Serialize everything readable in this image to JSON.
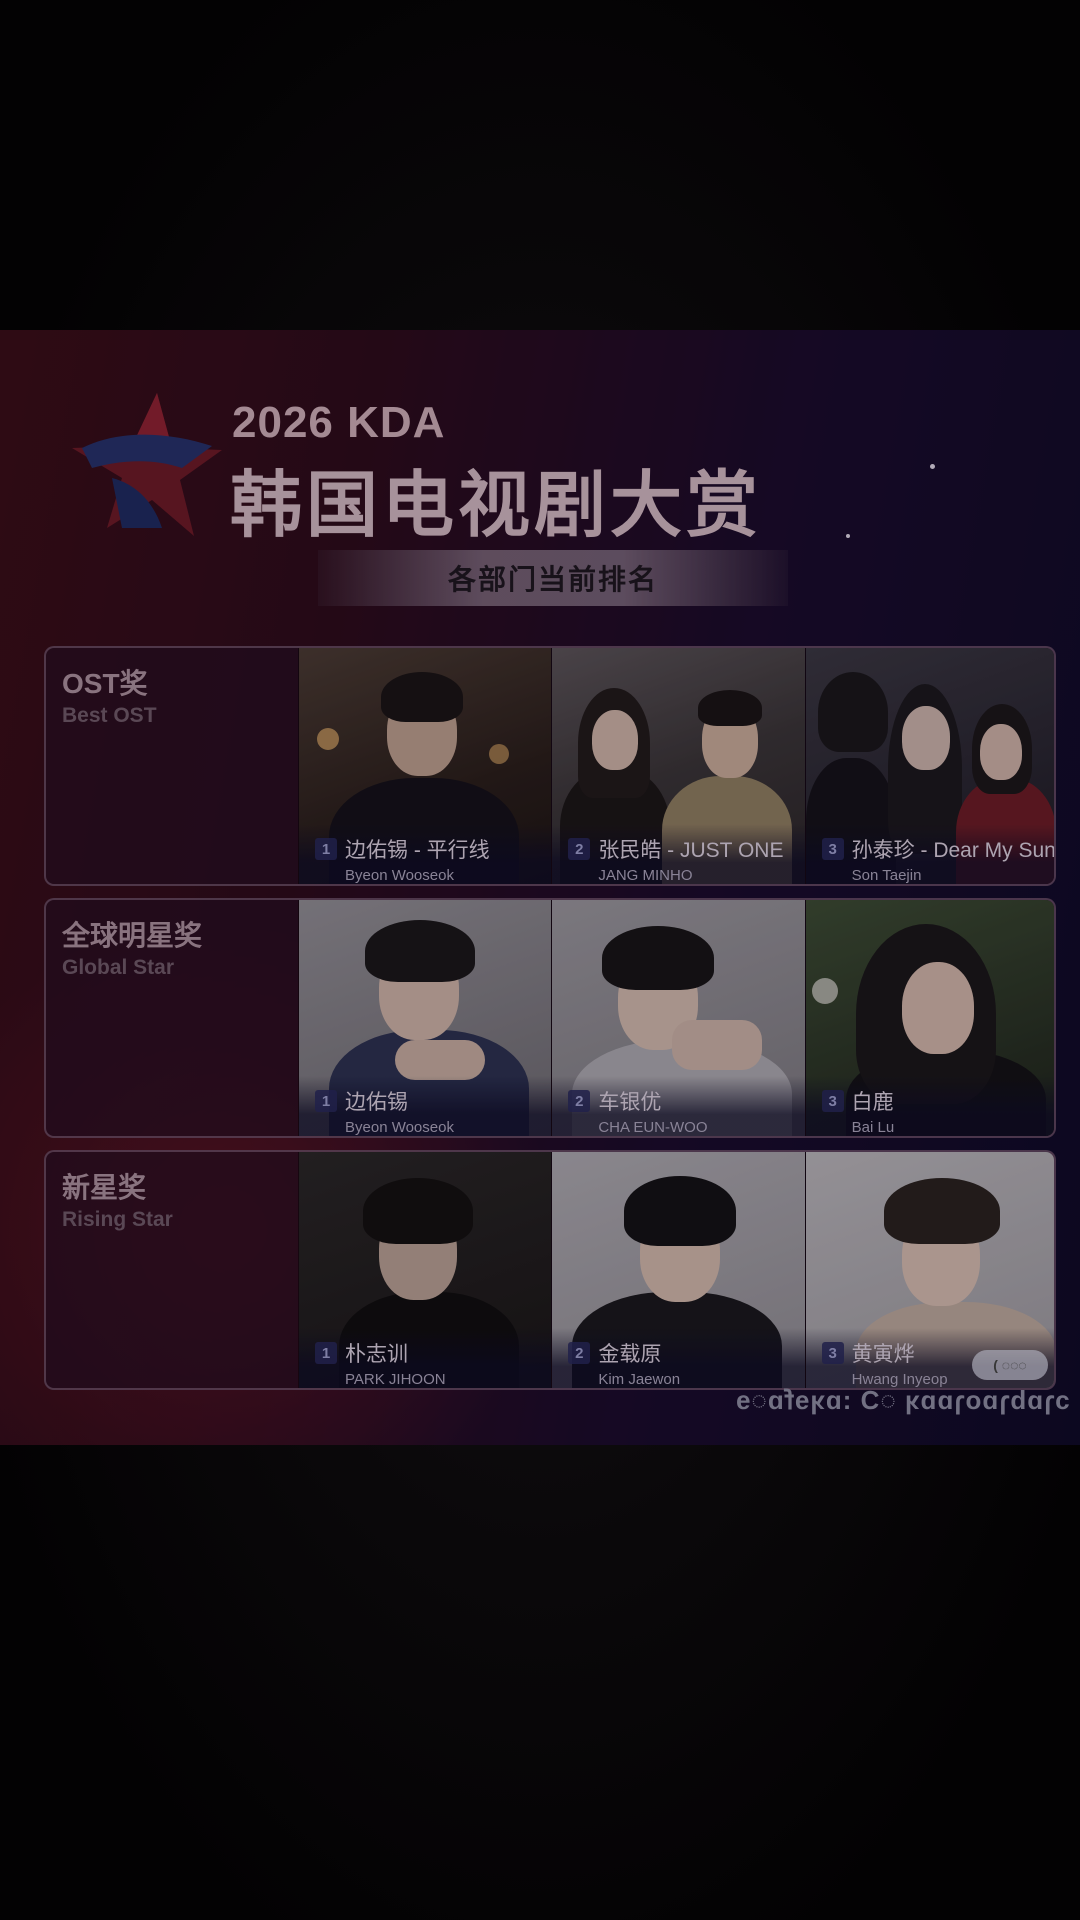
{
  "header": {
    "year_title": "2026 KDA",
    "main_title": "韩国电视剧大赏",
    "subtitle": "各部门当前排名"
  },
  "categories": [
    {
      "label_zh": "OST奖",
      "label_en": "Best OST",
      "entries": [
        {
          "rank": "1",
          "name_zh": "边佑锡 - 平行线",
          "name_en": "Byeon Wooseok"
        },
        {
          "rank": "2",
          "name_zh": "张民皓 - JUST ONE",
          "name_en": "JANG MINHO"
        },
        {
          "rank": "3",
          "name_zh": "孙泰珍 - Dear My Sun",
          "name_en": "Son Taejin"
        }
      ]
    },
    {
      "label_zh": "全球明星奖",
      "label_en": "Global Star",
      "entries": [
        {
          "rank": "1",
          "name_zh": "边佑锡",
          "name_en": "Byeon Wooseok"
        },
        {
          "rank": "2",
          "name_zh": "车银优",
          "name_en": "CHA EUN-WOO"
        },
        {
          "rank": "3",
          "name_zh": "白鹿",
          "name_en": "Bai Lu"
        }
      ]
    },
    {
      "label_zh": "新星奖",
      "label_en": "Rising Star",
      "entries": [
        {
          "rank": "1",
          "name_zh": "朴志训",
          "name_en": "PARK JIHOON"
        },
        {
          "rank": "2",
          "name_zh": "金载原",
          "name_en": "Kim Jaewon"
        },
        {
          "rank": "3",
          "name_zh": "黄寅烨",
          "name_en": "Hwang Inyeop"
        }
      ]
    }
  ],
  "footer": {
    "mirrored_text": "ɔɿɒbɿɒoɿɒɒʞ ◌Ɔ :ɒʞɘ𝖿ɒ◌ɘ",
    "pill_label": "( ◌◌◌"
  },
  "colors": {
    "poster_red": "#4a1220",
    "poster_navy": "#140e34",
    "title_text": "#ccb3bd"
  }
}
